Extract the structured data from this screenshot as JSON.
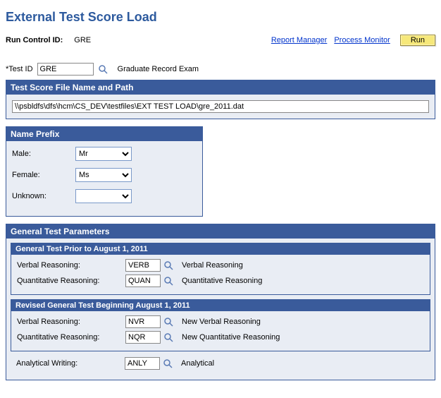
{
  "page_title": "External Test Score Load",
  "topbar": {
    "run_control_label": "Run Control ID:",
    "run_control_value": "GRE",
    "report_manager": "Report Manager",
    "process_monitor": "Process Monitor",
    "run_button": "Run"
  },
  "test_id": {
    "label": "*Test ID",
    "value": "GRE",
    "description": "Graduate Record Exam"
  },
  "file_section": {
    "header": "Test Score File Name and Path",
    "path": "\\\\psbldfs\\dfs\\hcm\\CS_DEV\\testfiles\\EXT TEST LOAD\\gre_2011.dat"
  },
  "prefix_section": {
    "header": "Name Prefix",
    "rows": [
      {
        "label": "Male:",
        "value": "Mr"
      },
      {
        "label": "Female:",
        "value": "Ms"
      },
      {
        "label": "Unknown:",
        "value": ""
      }
    ]
  },
  "params_section": {
    "header": "General Test Parameters",
    "prior": {
      "header": "General Test Prior to August 1, 2011",
      "rows": [
        {
          "label": "Verbal Reasoning:",
          "code": "VERB",
          "desc": "Verbal Reasoning"
        },
        {
          "label": "Quantitative Reasoning:",
          "code": "QUAN",
          "desc": "Quantitative Reasoning"
        }
      ]
    },
    "revised": {
      "header": "Revised General Test Beginning August 1, 2011",
      "rows": [
        {
          "label": "Verbal Reasoning:",
          "code": "NVR",
          "desc": "New Verbal Reasoning"
        },
        {
          "label": "Quantitative Reasoning:",
          "code": "NQR",
          "desc": "New Quantitative Reasoning"
        }
      ]
    },
    "analytical": {
      "label": "Analytical Writing:",
      "code": "ANLY",
      "desc": "Analytical"
    }
  }
}
